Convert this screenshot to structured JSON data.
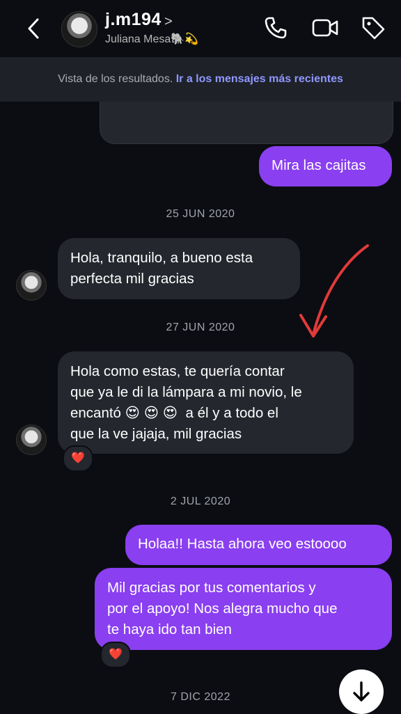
{
  "header": {
    "username": "j.m194",
    "username_chevron": ">",
    "fullname": "Juliana Mesa🐘💫",
    "icons": [
      "back-icon",
      "phone-icon",
      "video-icon",
      "tag-icon"
    ]
  },
  "banner": {
    "text": "Vista de los resultados.",
    "link": "Ir a los mensajes más recientes"
  },
  "messages": {
    "m1": "Mira las cajitas",
    "d1": "25 JUN 2020",
    "m2": "Hola, tranquilo, a bueno esta\nperfecta mil gracias",
    "d2": "27 JUN 2020",
    "m3": "Hola como estas, te quería contar\nque ya le di la lámpara a mi novio, le\nencantó 😍 😍 😍  a él y a todo el\nque la ve jajaja, mil gracias",
    "m3_reaction": "❤️",
    "d3": "2 JUL 2020",
    "m4": "Holaa!! Hasta ahora veo estoooo",
    "m5": "Mil gracias por tus comentarios y\npor el apoyo! Nos alegra mucho que\nte haya ido tan bien",
    "m5_reaction": "❤️",
    "d4": "7 DIC 2022"
  },
  "colors": {
    "background": "#0b0d12",
    "incoming_bubble": "#24272e",
    "outgoing_bubble": "#8a3ff0",
    "link": "#8f97ff",
    "annotation_arrow": "#e23a3a"
  }
}
